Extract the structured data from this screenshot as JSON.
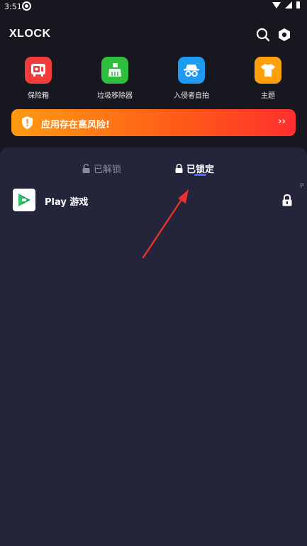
{
  "status_bar": {
    "time": "3:51"
  },
  "header": {
    "app_name": "XLOCK"
  },
  "features": [
    {
      "label": "保险箱",
      "icon": "safe-icon",
      "color": "#f23c3c"
    },
    {
      "label": "垃圾移除器",
      "icon": "broom-icon",
      "color": "#2fbd3d"
    },
    {
      "label": "入侵者自拍",
      "icon": "spy-icon",
      "color": "#1e9bf0"
    },
    {
      "label": "主题",
      "icon": "tshirt-icon",
      "color": "#ff9f0a"
    }
  ],
  "banner": {
    "text": "应用存在高风险!",
    "chevron": "››"
  },
  "tabs": {
    "unlocked": "已解锁",
    "locked": "已锁定"
  },
  "apps": [
    {
      "name": "Play 游戏",
      "locked": true
    }
  ],
  "edge_label": "P",
  "colors": {
    "accent": "#4a6cff",
    "panel": "#24253a",
    "background": "#17171f",
    "annotation_arrow": "#e8322d"
  }
}
